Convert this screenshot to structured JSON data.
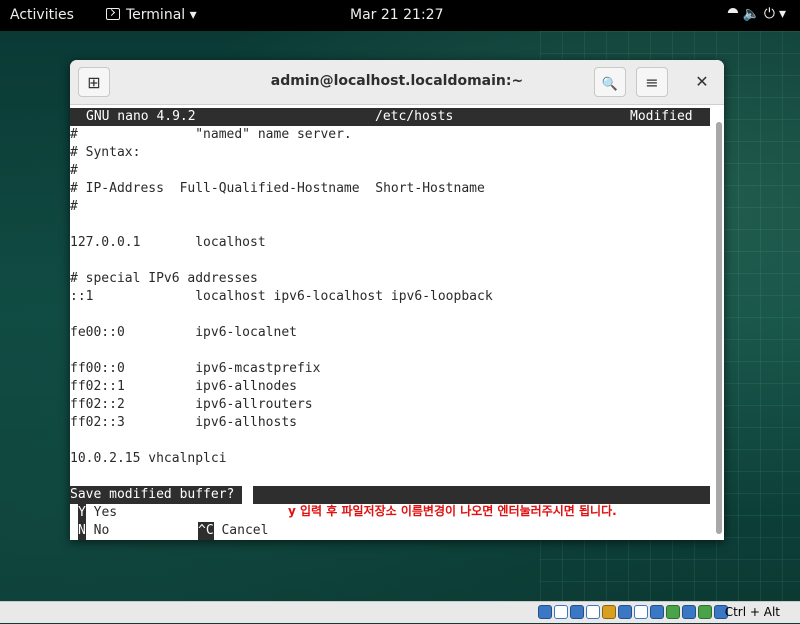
{
  "topbar": {
    "activities": "Activities",
    "app_name": "Terminal",
    "app_dropdown": "▾",
    "clock": "Mar 21  21:27",
    "tray_network": "⯊",
    "tray_volume": "🔈",
    "tray_power": "⏻",
    "tray_dropdown": "▾"
  },
  "window": {
    "title": "admin@localhost.localdomain:~",
    "newtab_icon": "⊞",
    "search_icon": "🔍",
    "menu_icon": "≡",
    "close_icon": "✕"
  },
  "nano": {
    "version": "GNU nano 4.9.2",
    "filename": "/etc/hosts",
    "status": "Modified",
    "lines": [
      "#               \"named\" name server.",
      "# Syntax:",
      "#",
      "# IP-Address  Full-Qualified-Hostname  Short-Hostname",
      "#",
      "",
      "127.0.0.1       localhost",
      "",
      "# special IPv6 addresses",
      "::1             localhost ipv6-localhost ipv6-loopback",
      "",
      "fe00::0         ipv6-localnet",
      "",
      "ff00::0         ipv6-mcastprefix",
      "ff02::1         ipv6-allnodes",
      "ff02::2         ipv6-allrouters",
      "ff02::3         ipv6-allhosts",
      "",
      "10.0.2.15 vhcalnplci"
    ],
    "prompt": "Save modified buffer?",
    "option_yes_key": "Y",
    "option_yes_label": "Yes",
    "option_no_key": "N",
    "option_no_label": "No",
    "option_cancel_key": "^C",
    "option_cancel_label": "Cancel"
  },
  "annotation": "y 입력 후 파일저장소 이름변경이 나오면 엔터눌러주시면 됩니다.",
  "statusbar": {
    "hostkey": "Ctrl + Alt"
  }
}
